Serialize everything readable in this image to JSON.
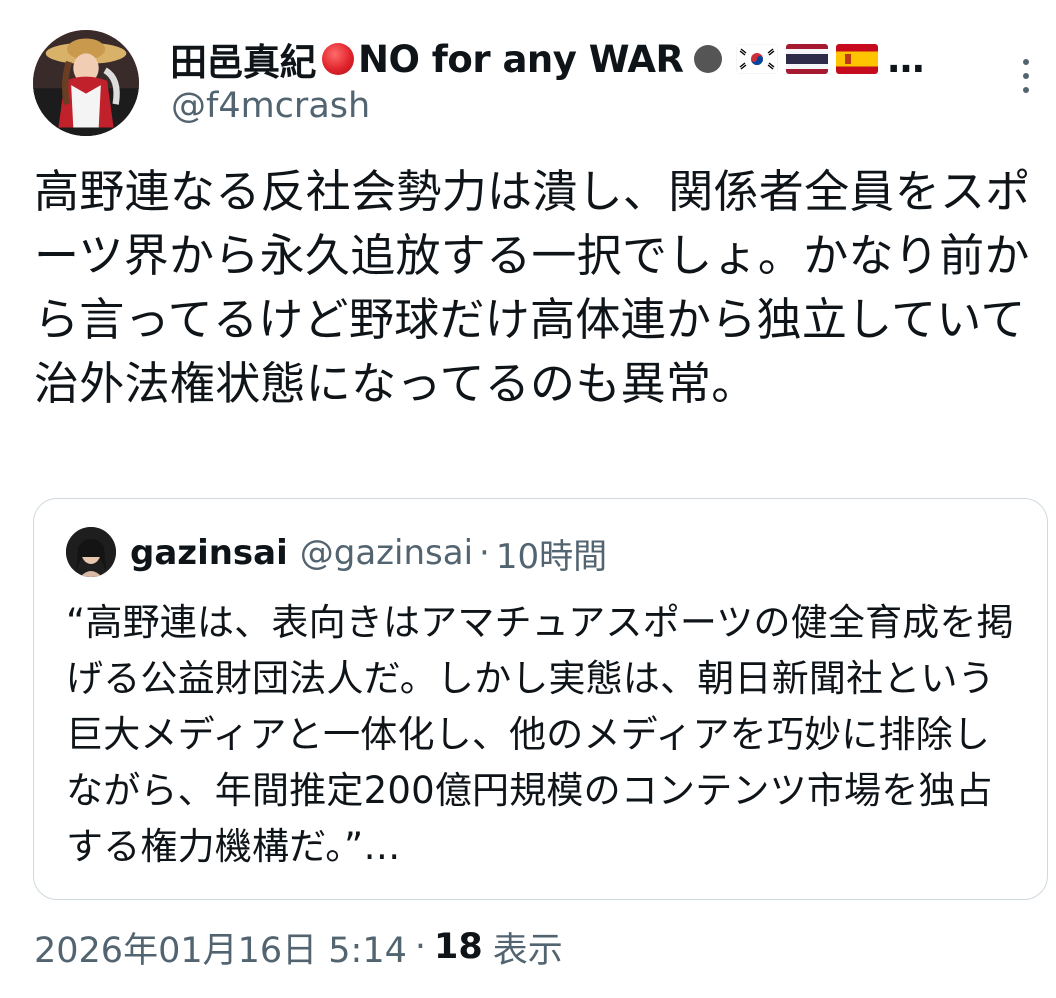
{
  "tweet": {
    "author": {
      "name": "田邑真紀",
      "name_suffix": "NO for any WAR",
      "ellipsis": "…",
      "handle": "@f4mcrash",
      "flags": [
        "korea-flag",
        "thailand-flag",
        "spain-flag"
      ]
    },
    "text": "高野連なる反社会勢力は潰し、関係者全員をスポーツ界から永久追放する一択でしょ。かなり前から言ってるけど野球だけ高体連から独立していて治外法権状態になってるのも異常。",
    "quoted": {
      "name": "gazinsai",
      "handle": "@gazinsai",
      "separator": "·",
      "time": "10時間",
      "text": "“高野連は、表向きはアマチュアスポーツの健全育成を掲げる公益財団法人だ。しかし実態は、朝日新聞社という巨大メディアと一体化し、他のメディアを巧妙に排除しながら、年間推定200億円規模のコンテンツ市場を独占する権力機構だ。”…"
    },
    "footer": {
      "date": "2026年01月16日 5:14",
      "separator": "·",
      "views_count": "18",
      "views_label": "表示"
    }
  },
  "colors": {
    "text_primary": "#0f1419",
    "text_secondary": "#536471",
    "border": "#cfd9de",
    "red_dot": "#e0242c"
  },
  "icons": [
    "more-options-icon",
    "red-circle-icon",
    "black-circle-icon"
  ]
}
